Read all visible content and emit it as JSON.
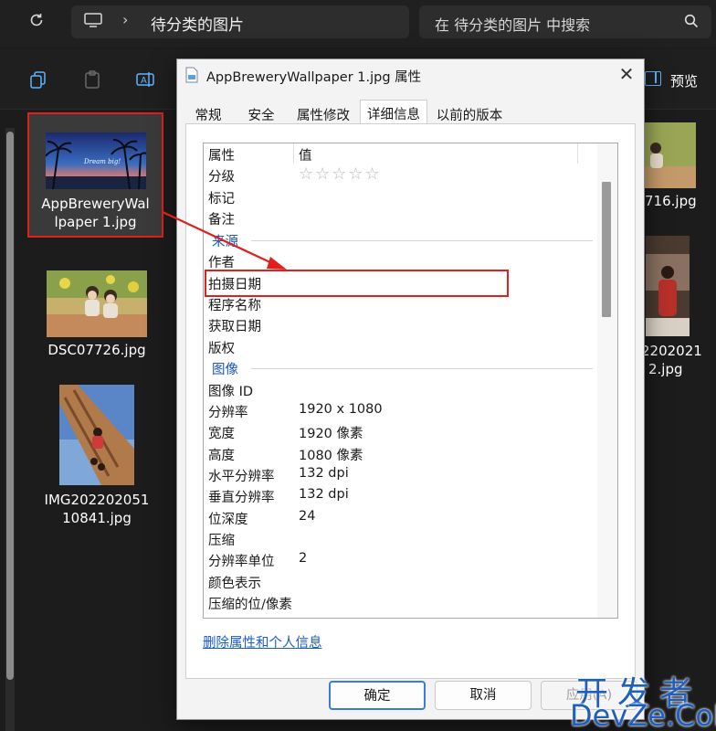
{
  "address": {
    "path": "待分类的图片"
  },
  "search": {
    "placeholder": "在 待分类的图片 中搜索"
  },
  "toolbar": {
    "preview_label": "预览"
  },
  "files": [
    {
      "name": "AppBreweryWallpaper 1.jpg",
      "line1": "AppBreweryWal",
      "line2": "lpaper 1.jpg",
      "thumb_text": "Dream big!"
    },
    {
      "name": "DSC07726.jpg",
      "line1": "DSC07726.jpg"
    },
    {
      "name": "IMG20220205110841.jpg",
      "line1": "IMG202202051",
      "line2": "10841.jpg"
    },
    {
      "name": "…716.jpg",
      "line1": "716.jpg"
    },
    {
      "name": "IMG2022021…2.jpg",
      "line1": "2202021",
      "line2": "2.jpg"
    }
  ],
  "dialog": {
    "title": "AppBreweryWallpaper 1.jpg 属性",
    "tabs": [
      "常规",
      "安全",
      "属性修改",
      "详细信息",
      "以前的版本"
    ],
    "active_tab": "详细信息",
    "header": {
      "key": "属性",
      "value": "值"
    },
    "rows": [
      {
        "k": "分级",
        "v": ""
      },
      {
        "k": "标记",
        "v": ""
      },
      {
        "k": "备注",
        "v": ""
      }
    ],
    "rating": "☆☆☆☆☆",
    "group_source": "来源",
    "source_rows": [
      {
        "k": "作者",
        "v": ""
      },
      {
        "k": "拍摄日期",
        "v": ""
      },
      {
        "k": "程序名称",
        "v": ""
      },
      {
        "k": "获取日期",
        "v": ""
      },
      {
        "k": "版权",
        "v": ""
      }
    ],
    "group_image": "图像",
    "image_rows": [
      {
        "k": "图像 ID",
        "v": ""
      },
      {
        "k": "分辨率",
        "v": "1920 x 1080"
      },
      {
        "k": "宽度",
        "v": "1920 像素"
      },
      {
        "k": "高度",
        "v": "1080 像素"
      },
      {
        "k": "水平分辨率",
        "v": "132 dpi"
      },
      {
        "k": "垂直分辨率",
        "v": "132 dpi"
      },
      {
        "k": "位深度",
        "v": "24"
      },
      {
        "k": "压缩",
        "v": ""
      },
      {
        "k": "分辨率单位",
        "v": "2"
      },
      {
        "k": "颜色表示",
        "v": ""
      },
      {
        "k": "压缩的位/像素",
        "v": ""
      }
    ],
    "remove_link": "删除属性和个人信息",
    "buttons": {
      "ok": "确定",
      "cancel": "取消",
      "apply": "应用(A)"
    }
  },
  "watermark": {
    "line1": "开发者",
    "line2": "DevZe.CoM"
  },
  "colors": {
    "highlight": "#e0201b",
    "link": "#1a5bd6",
    "group": "#1e57b5",
    "accent": "#60b3ff"
  }
}
